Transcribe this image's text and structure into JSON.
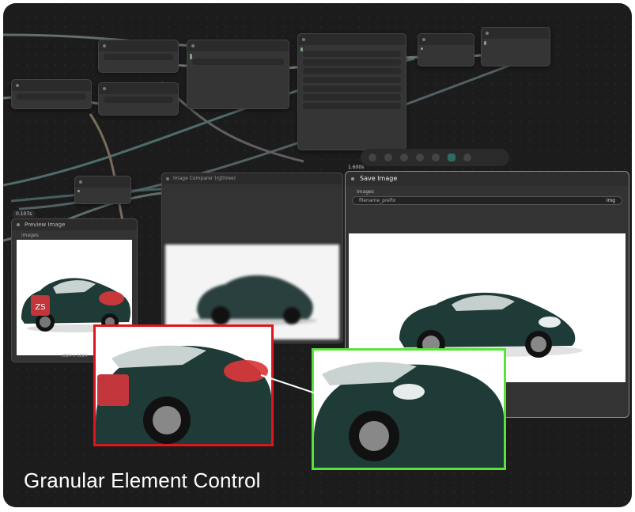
{
  "caption": "Granular Element Control",
  "colors": {
    "background": "#1c1c1c",
    "before_outline": "#e0141b",
    "after_outline": "#58e33a",
    "car_body": "#1f3b37",
    "mask": "#d9383a"
  },
  "preview_node": {
    "title": "Preview Image",
    "input_label": "images",
    "size_label": "1024 × 1024",
    "time": "0.107s"
  },
  "save_node": {
    "title": "Save Image",
    "input_label": "images",
    "filename_label": "filename_prefix",
    "filename_value": "img",
    "time": "1.600s"
  },
  "compare_node": {
    "title": "Image Comparer (rgthree)"
  },
  "toolbar": {
    "icons": [
      "settings-icon",
      "record-icon",
      "stop-icon",
      "queue-icon",
      "play-icon",
      "more-icon"
    ]
  },
  "preview_logo_text": "ZS"
}
